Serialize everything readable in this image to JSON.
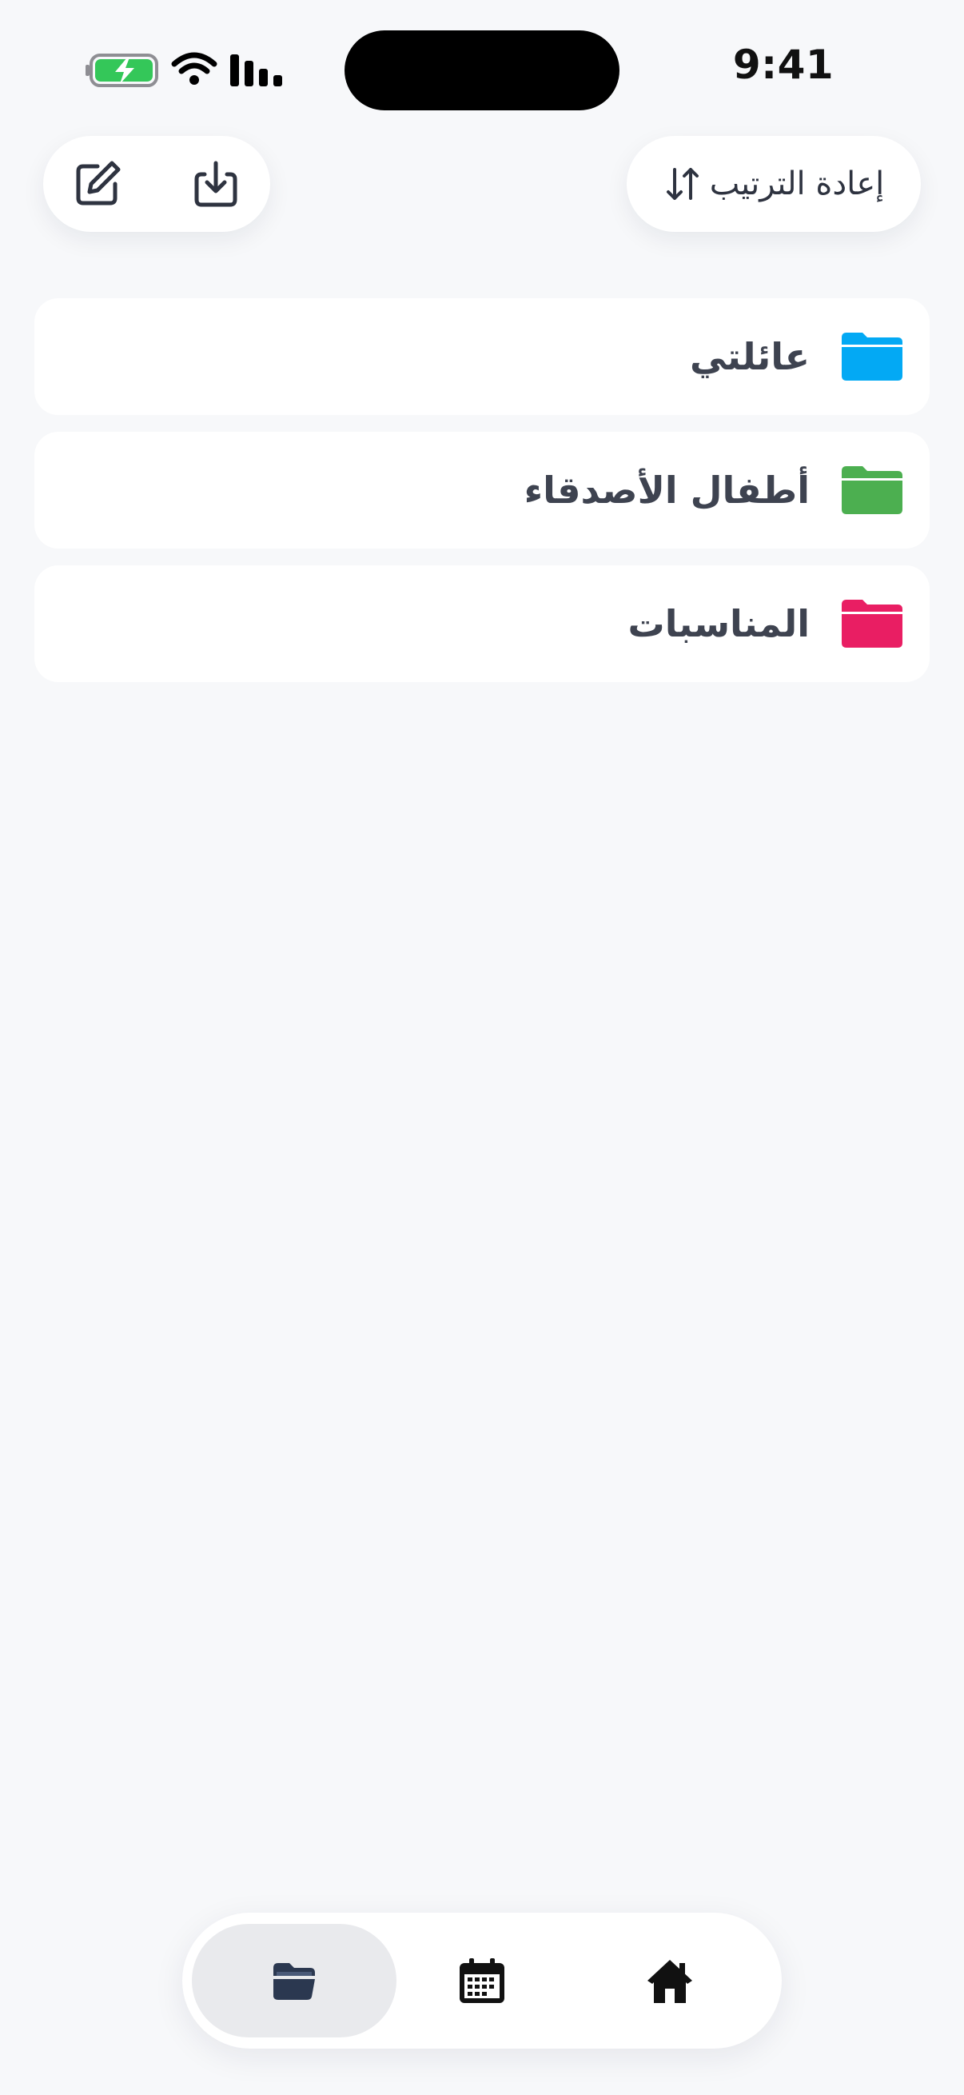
{
  "status_bar": {
    "time": "9:41",
    "battery_icon": "battery-charging-icon",
    "wifi_icon": "wifi-icon",
    "signal_icon": "signal-icon"
  },
  "toolbar": {
    "edit_icon": "edit-icon",
    "download_icon": "download-icon",
    "reorder_label": "إعادة الترتيب",
    "reorder_icon": "sort-arrows-icon"
  },
  "folders": [
    {
      "label": "عائلتي",
      "color": "#03A9F4",
      "icon": "folder-icon"
    },
    {
      "label": "أطفال الأصدقاء",
      "color": "#4CAF50",
      "icon": "folder-icon"
    },
    {
      "label": "المناسبات",
      "color": "#E91E63",
      "icon": "folder-icon"
    }
  ],
  "tabbar": {
    "tabs": [
      {
        "name": "folders",
        "icon": "open-folder-icon",
        "active": true
      },
      {
        "name": "calendar",
        "icon": "calendar-icon",
        "active": false
      },
      {
        "name": "home",
        "icon": "home-icon",
        "active": false
      }
    ],
    "active_color": "#2B3850"
  }
}
